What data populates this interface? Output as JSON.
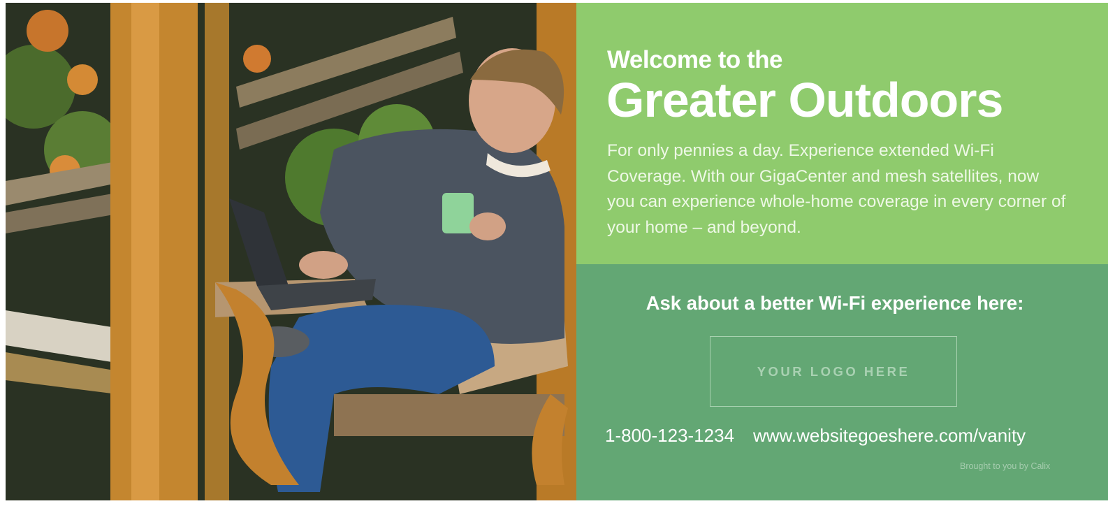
{
  "hero": {
    "welcome": "Welcome to the",
    "headline": "Greater Outdoors",
    "body": "For only pennies a day. Experience extended Wi-Fi Coverage. With our GigaCenter and mesh satellites, now you can experience whole-home coverage in every corner of your home – and beyond."
  },
  "cta": {
    "ask": "Ask about a better Wi-Fi experience here:",
    "logo_placeholder": "YOUR LOGO HERE",
    "phone": "1-800-123-1234",
    "website": "www.websitegoeshere.com/vanity",
    "credit": "Brought to you by Calix"
  },
  "colors": {
    "top_panel": "#8fcb6d",
    "bottom_panel": "#63a774",
    "logo_outline": "#a8d2b0"
  }
}
